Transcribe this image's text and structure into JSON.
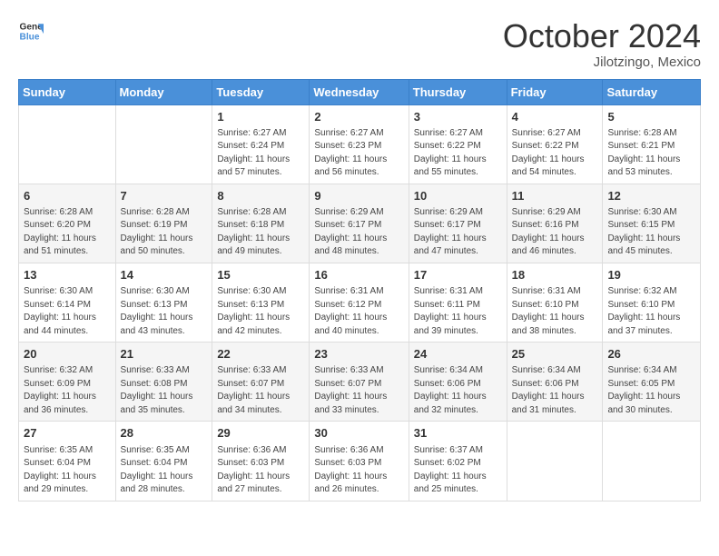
{
  "logo": {
    "line1": "General",
    "line2": "Blue"
  },
  "title": "October 2024",
  "subtitle": "Jilotzingo, Mexico",
  "weekdays": [
    "Sunday",
    "Monday",
    "Tuesday",
    "Wednesday",
    "Thursday",
    "Friday",
    "Saturday"
  ],
  "weeks": [
    [
      {
        "day": "",
        "info": ""
      },
      {
        "day": "",
        "info": ""
      },
      {
        "day": "1",
        "info": "Sunrise: 6:27 AM\nSunset: 6:24 PM\nDaylight: 11 hours and 57 minutes."
      },
      {
        "day": "2",
        "info": "Sunrise: 6:27 AM\nSunset: 6:23 PM\nDaylight: 11 hours and 56 minutes."
      },
      {
        "day": "3",
        "info": "Sunrise: 6:27 AM\nSunset: 6:22 PM\nDaylight: 11 hours and 55 minutes."
      },
      {
        "day": "4",
        "info": "Sunrise: 6:27 AM\nSunset: 6:22 PM\nDaylight: 11 hours and 54 minutes."
      },
      {
        "day": "5",
        "info": "Sunrise: 6:28 AM\nSunset: 6:21 PM\nDaylight: 11 hours and 53 minutes."
      }
    ],
    [
      {
        "day": "6",
        "info": "Sunrise: 6:28 AM\nSunset: 6:20 PM\nDaylight: 11 hours and 51 minutes."
      },
      {
        "day": "7",
        "info": "Sunrise: 6:28 AM\nSunset: 6:19 PM\nDaylight: 11 hours and 50 minutes."
      },
      {
        "day": "8",
        "info": "Sunrise: 6:28 AM\nSunset: 6:18 PM\nDaylight: 11 hours and 49 minutes."
      },
      {
        "day": "9",
        "info": "Sunrise: 6:29 AM\nSunset: 6:17 PM\nDaylight: 11 hours and 48 minutes."
      },
      {
        "day": "10",
        "info": "Sunrise: 6:29 AM\nSunset: 6:17 PM\nDaylight: 11 hours and 47 minutes."
      },
      {
        "day": "11",
        "info": "Sunrise: 6:29 AM\nSunset: 6:16 PM\nDaylight: 11 hours and 46 minutes."
      },
      {
        "day": "12",
        "info": "Sunrise: 6:30 AM\nSunset: 6:15 PM\nDaylight: 11 hours and 45 minutes."
      }
    ],
    [
      {
        "day": "13",
        "info": "Sunrise: 6:30 AM\nSunset: 6:14 PM\nDaylight: 11 hours and 44 minutes."
      },
      {
        "day": "14",
        "info": "Sunrise: 6:30 AM\nSunset: 6:13 PM\nDaylight: 11 hours and 43 minutes."
      },
      {
        "day": "15",
        "info": "Sunrise: 6:30 AM\nSunset: 6:13 PM\nDaylight: 11 hours and 42 minutes."
      },
      {
        "day": "16",
        "info": "Sunrise: 6:31 AM\nSunset: 6:12 PM\nDaylight: 11 hours and 40 minutes."
      },
      {
        "day": "17",
        "info": "Sunrise: 6:31 AM\nSunset: 6:11 PM\nDaylight: 11 hours and 39 minutes."
      },
      {
        "day": "18",
        "info": "Sunrise: 6:31 AM\nSunset: 6:10 PM\nDaylight: 11 hours and 38 minutes."
      },
      {
        "day": "19",
        "info": "Sunrise: 6:32 AM\nSunset: 6:10 PM\nDaylight: 11 hours and 37 minutes."
      }
    ],
    [
      {
        "day": "20",
        "info": "Sunrise: 6:32 AM\nSunset: 6:09 PM\nDaylight: 11 hours and 36 minutes."
      },
      {
        "day": "21",
        "info": "Sunrise: 6:33 AM\nSunset: 6:08 PM\nDaylight: 11 hours and 35 minutes."
      },
      {
        "day": "22",
        "info": "Sunrise: 6:33 AM\nSunset: 6:07 PM\nDaylight: 11 hours and 34 minutes."
      },
      {
        "day": "23",
        "info": "Sunrise: 6:33 AM\nSunset: 6:07 PM\nDaylight: 11 hours and 33 minutes."
      },
      {
        "day": "24",
        "info": "Sunrise: 6:34 AM\nSunset: 6:06 PM\nDaylight: 11 hours and 32 minutes."
      },
      {
        "day": "25",
        "info": "Sunrise: 6:34 AM\nSunset: 6:06 PM\nDaylight: 11 hours and 31 minutes."
      },
      {
        "day": "26",
        "info": "Sunrise: 6:34 AM\nSunset: 6:05 PM\nDaylight: 11 hours and 30 minutes."
      }
    ],
    [
      {
        "day": "27",
        "info": "Sunrise: 6:35 AM\nSunset: 6:04 PM\nDaylight: 11 hours and 29 minutes."
      },
      {
        "day": "28",
        "info": "Sunrise: 6:35 AM\nSunset: 6:04 PM\nDaylight: 11 hours and 28 minutes."
      },
      {
        "day": "29",
        "info": "Sunrise: 6:36 AM\nSunset: 6:03 PM\nDaylight: 11 hours and 27 minutes."
      },
      {
        "day": "30",
        "info": "Sunrise: 6:36 AM\nSunset: 6:03 PM\nDaylight: 11 hours and 26 minutes."
      },
      {
        "day": "31",
        "info": "Sunrise: 6:37 AM\nSunset: 6:02 PM\nDaylight: 11 hours and 25 minutes."
      },
      {
        "day": "",
        "info": ""
      },
      {
        "day": "",
        "info": ""
      }
    ]
  ]
}
